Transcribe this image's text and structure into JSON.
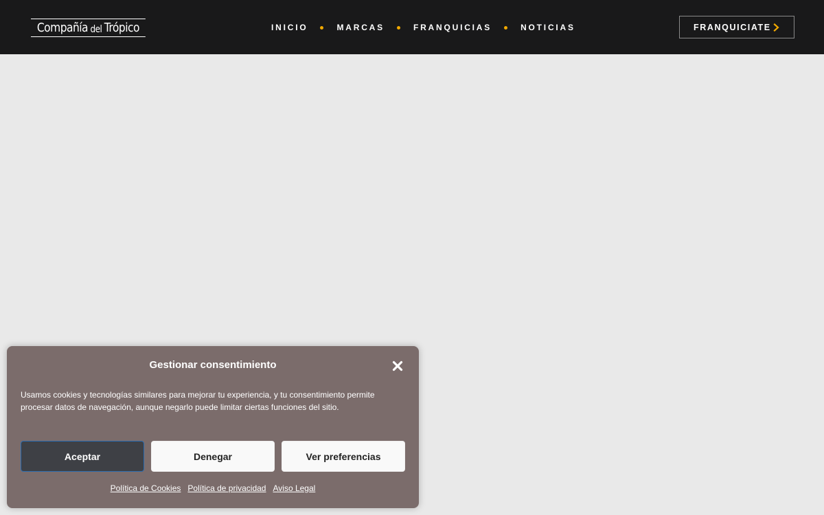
{
  "header": {
    "logo": {
      "part1": "Compañía",
      "part2": "del",
      "part3": "Trópico"
    },
    "nav": [
      {
        "label": "INICIO"
      },
      {
        "label": "MARCAS"
      },
      {
        "label": "FRANQUICIAS"
      },
      {
        "label": "NOTICIAS"
      }
    ],
    "cta": {
      "label": "FRANQUICIATE",
      "icon": "chevron-right-icon"
    }
  },
  "consent": {
    "title": "Gestionar consentimiento",
    "close_icon": "close-icon",
    "message": "Usamos cookies y tecnologías similares para mejorar tu experiencia, y tu consentimiento permite procesar datos de navegación, aunque negarlo puede limitar ciertas funciones del sitio.",
    "buttons": {
      "accept": "Aceptar",
      "deny": "Denegar",
      "preferences": "Ver preferencias"
    },
    "links": [
      {
        "label": "Política de Cookies"
      },
      {
        "label": "Política de privacidad"
      },
      {
        "label": "Aviso Legal"
      }
    ]
  },
  "colors": {
    "header_bg": "#19191a",
    "accent": "#f2a900",
    "page_bg": "#e9e9e9",
    "dialog_bg": "#7b6c6b",
    "accept_bg": "#3e4045"
  }
}
